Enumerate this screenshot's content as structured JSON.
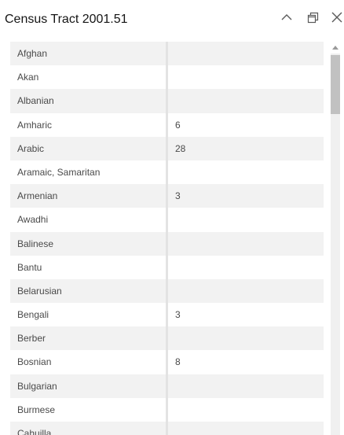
{
  "panel": {
    "title": "Census Tract 2001.51"
  },
  "icons": {
    "collapse": "chevron-up-icon",
    "dock": "dock-window-icon",
    "close": "close-icon"
  },
  "table": {
    "rows": [
      {
        "name": "Afghan",
        "value": ""
      },
      {
        "name": "Akan",
        "value": ""
      },
      {
        "name": "Albanian",
        "value": ""
      },
      {
        "name": "Amharic",
        "value": "6"
      },
      {
        "name": "Arabic",
        "value": "28"
      },
      {
        "name": "Aramaic, Samaritan",
        "value": ""
      },
      {
        "name": "Armenian",
        "value": "3"
      },
      {
        "name": "Awadhi",
        "value": ""
      },
      {
        "name": "Balinese",
        "value": ""
      },
      {
        "name": "Bantu",
        "value": ""
      },
      {
        "name": "Belarusian",
        "value": ""
      },
      {
        "name": "Bengali",
        "value": "3"
      },
      {
        "name": "Berber",
        "value": ""
      },
      {
        "name": "Bosnian",
        "value": "8"
      },
      {
        "name": "Bulgarian",
        "value": ""
      },
      {
        "name": "Burmese",
        "value": ""
      },
      {
        "name": "Cahuilla",
        "value": ""
      }
    ]
  }
}
